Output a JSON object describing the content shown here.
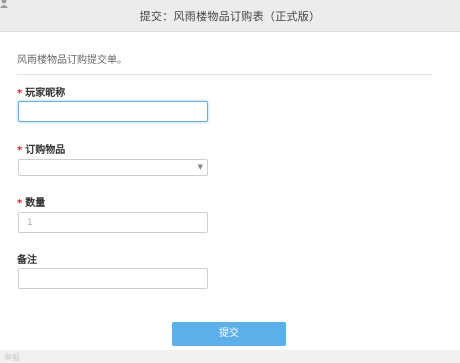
{
  "window": {
    "title": "提交：风雨楼物品订购表（正式版）"
  },
  "form": {
    "description": "风雨楼物品订购提交单。",
    "required_mark": "*",
    "fields": [
      {
        "label": "玩家昵称",
        "required": true,
        "value": "",
        "placeholder": ""
      },
      {
        "label": "订购物品",
        "required": true,
        "value": "",
        "type": "select"
      },
      {
        "label": "数量",
        "required": true,
        "value": "",
        "placeholder": "1"
      },
      {
        "label": "备注",
        "required": false,
        "value": "",
        "placeholder": ""
      }
    ],
    "submit_label": "提交"
  },
  "footer": {
    "text": "举报"
  }
}
